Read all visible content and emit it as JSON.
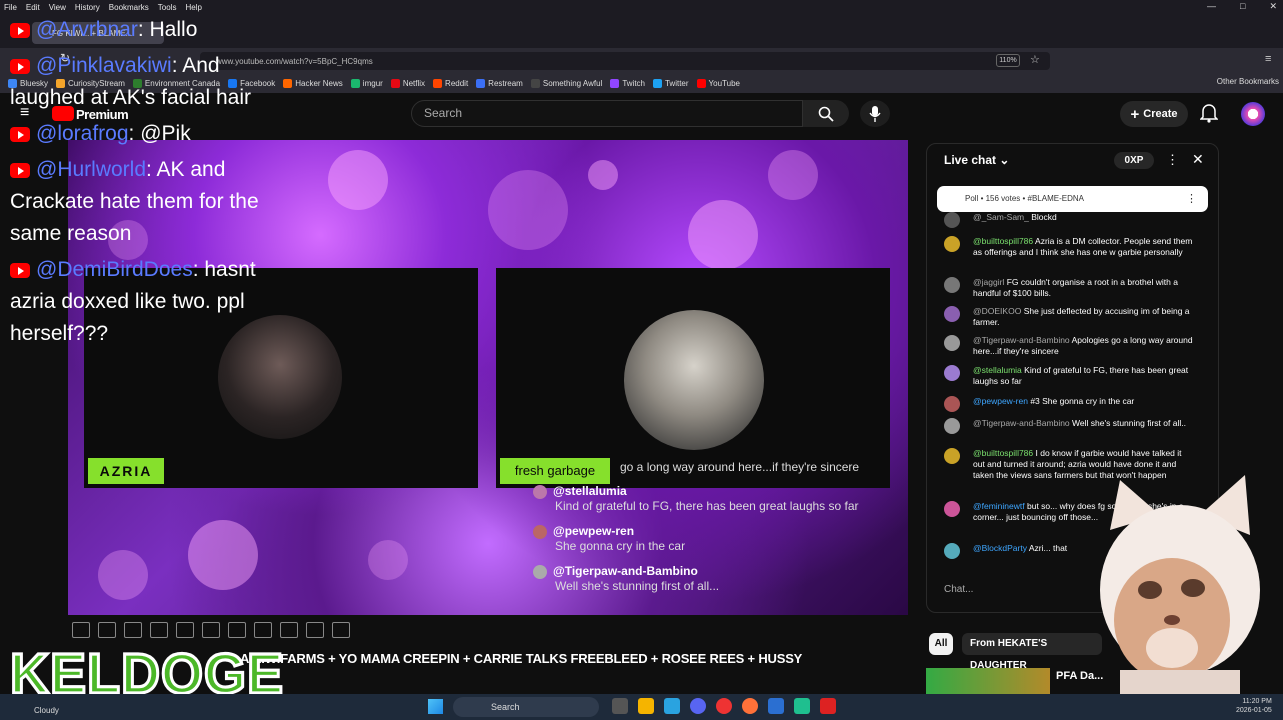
{
  "browser": {
    "menu": [
      "File",
      "Edit",
      "View",
      "History",
      "Bookmarks",
      "Tools",
      "Help"
    ],
    "tab_title": "FG KIWI... + BLAME...",
    "url": "www.youtube.com/watch?v=5BpC_HC9qms",
    "zoom": "110%",
    "bookmarks": [
      {
        "label": "Bluesky",
        "color": "#3d86f5"
      },
      {
        "label": "CuriosityStream",
        "color": "#f4a52b"
      },
      {
        "label": "Environment Canada",
        "color": "#2d7d2d"
      },
      {
        "label": "Facebook",
        "color": "#1877f2"
      },
      {
        "label": "Hacker News",
        "color": "#ff6600"
      },
      {
        "label": "imgur",
        "color": "#1bb76e"
      },
      {
        "label": "Netflix",
        "color": "#e50914"
      },
      {
        "label": "Reddit",
        "color": "#ff4500"
      },
      {
        "label": "Restream",
        "color": "#3b6ff5"
      },
      {
        "label": "Something Awful",
        "color": "#444"
      },
      {
        "label": "Twitch",
        "color": "#9146ff"
      },
      {
        "label": "Twitter",
        "color": "#1da1f2"
      },
      {
        "label": "YouTube",
        "color": "#ff0000"
      }
    ],
    "other_bookmarks": "Other Bookmarks"
  },
  "youtube": {
    "logo_text": "Premium",
    "search_placeholder": "Search",
    "create_label": "Create",
    "video_title": "A KIWIFARMS + YO MAMA CREEPIN + CARRIE TALKS FREEBLEED + ROSEE REES + HUSSY"
  },
  "stream": {
    "left_name": "AZRIA",
    "right_name": "fresh garbage",
    "overlay_chat": [
      {
        "user": "",
        "text": "go a long way around here...if they're sincere"
      },
      {
        "user": "@stellalumia",
        "text": "Kind of grateful to FG, there has been great laughs so far"
      },
      {
        "user": "@pewpew-ren",
        "text": "She gonna cry in the car"
      },
      {
        "user": "@Tigerpaw-and-Bambino",
        "text": "Well she's stunning first of all..."
      }
    ]
  },
  "left_chat": [
    {
      "user": "@Arvrbnar",
      "text": "Hallo"
    },
    {
      "user": "@Pinklavakiwi",
      "text": "And laughed at AK's facial hair"
    },
    {
      "user": "@lorafrog",
      "text": "@Pik"
    },
    {
      "user": "@Hurlworld",
      "text": "AK and Crackate hate them for the same reason"
    },
    {
      "user": "@DemiBirdDoes",
      "text": "hasnt azria doxxed like two. ppl herself???"
    }
  ],
  "live_chat": {
    "title": "Live chat",
    "xp": "0XP",
    "poll": "Poll • 156 votes • #BLAME-EDNA",
    "input_placeholder": "Chat...",
    "messages": [
      {
        "author": "@_Sam-Sam_",
        "text": "Blockd",
        "type": "p",
        "av": "#555"
      },
      {
        "author": "@builttospill786",
        "text": "Azria is a DM collector. People send them as offerings and I think she has one w garbie personally",
        "type": "g",
        "av": "#c9a227"
      },
      {
        "author": "@jaggirl",
        "text": "FG couldn't organise a root in a brothel with a handful of $100 bills.",
        "type": "p",
        "av": "#777"
      },
      {
        "author": "@DOEIKOO",
        "text": "She just deflected by accusing im of being a farmer.",
        "type": "p",
        "av": "#8a5fb0"
      },
      {
        "author": "@Tigerpaw-and-Bambino",
        "text": "Apologies go a long way around here...if they're sincere",
        "type": "p",
        "av": "#999"
      },
      {
        "author": "@stellalumia",
        "text": "Kind of grateful to FG, there has been great laughs so far",
        "type": "g",
        "av": "#9b7bd0"
      },
      {
        "author": "@pewpew-ren",
        "text": "#3   She gonna cry in the car",
        "type": "b",
        "av": "#a55"
      },
      {
        "author": "@Tigerpaw-and-Bambino",
        "text": "Well she's stunning first of all..",
        "type": "p",
        "av": "#999"
      },
      {
        "author": "@builttospill786",
        "text": "I do know if garbie would have talked it out and turned it around; azria would have done it and taken the views sans farmers but that won't happen",
        "type": "g",
        "av": "#c9a227"
      },
      {
        "author": "@femininewtf",
        "text": "but so... why does fg sound like she's in a corner... just bouncing off those...",
        "type": "b",
        "av": "#c59"
      },
      {
        "author": "@BlockdParty",
        "text": "Azri... that",
        "type": "b",
        "av": "#5ab"
      }
    ]
  },
  "chips": {
    "all": "All",
    "second": "From HEKATE'S DAUGHTER"
  },
  "recommend_thumb_title": "PFA Da...",
  "keldoge": "KELDOGE",
  "taskbar": {
    "weather": "Cloudy",
    "search": "Search",
    "time": "11:20 PM",
    "date": "2026-01-05"
  }
}
